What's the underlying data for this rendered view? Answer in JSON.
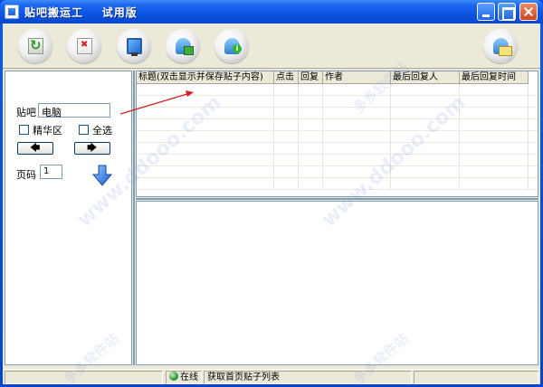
{
  "window": {
    "title": "贴吧搬运工    试用版"
  },
  "toolbar": {
    "buttons": [
      {
        "name": "refresh",
        "icon": "refresh-icon"
      },
      {
        "name": "delete",
        "icon": "delete-document-icon"
      },
      {
        "name": "monitor",
        "icon": "monitor-icon"
      },
      {
        "name": "user",
        "icon": "user-icon"
      },
      {
        "name": "info",
        "icon": "info-icon"
      },
      {
        "name": "mail",
        "icon": "mail-icon"
      }
    ]
  },
  "left": {
    "forum_label": "贴吧",
    "forum_value": "电脑",
    "essence_label": "精华区",
    "select_all_label": "全选",
    "prev_glyph": "🡄",
    "next_glyph": "🡆",
    "page_label": "页码",
    "page_value": "1"
  },
  "grid": {
    "columns": [
      "标题(双击显示并保存贴子内容)",
      "点击",
      "回复",
      "作者",
      "最后回复人",
      "最后回复时间"
    ]
  },
  "status": {
    "online": "在线",
    "message": "获取首页贴子列表"
  },
  "watermark": {
    "site": "www.ddooo.com",
    "cn": "多多软件站"
  },
  "colors": {
    "title_bar": "#0a54e3",
    "client_bg": "#ece9d8",
    "arrow_annotation": "#d42020",
    "border": "#7f9db9"
  }
}
